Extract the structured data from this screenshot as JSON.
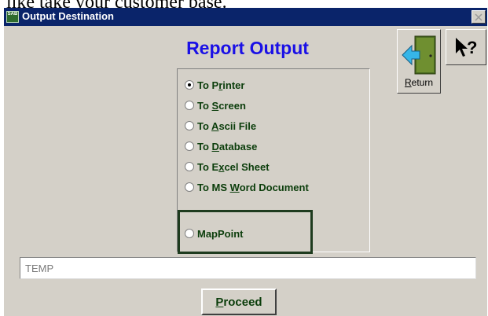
{
  "page": {
    "top_caption": "like take your customer base."
  },
  "window": {
    "title": "Output Destination",
    "app_icon_text": "SAB"
  },
  "report_title": "Report Output",
  "return_button": {
    "label_underlined": "R",
    "label_rest": "eturn"
  },
  "options": [
    {
      "pre": "To P",
      "accel": "r",
      "post": "inter",
      "selected": true
    },
    {
      "pre": "To ",
      "accel": "S",
      "post": "creen",
      "selected": false
    },
    {
      "pre": "To ",
      "accel": "A",
      "post": "scii File",
      "selected": false
    },
    {
      "pre": "To ",
      "accel": "D",
      "post": "atabase",
      "selected": false
    },
    {
      "pre": "To E",
      "accel": "x",
      "post": "cel Sheet",
      "selected": false
    },
    {
      "pre": "To MS ",
      "accel": "W",
      "post": "ord Document",
      "selected": false
    },
    {
      "pre": "MapPoint",
      "accel": "",
      "post": "",
      "selected": false
    }
  ],
  "temp_field": {
    "value": "TEMP"
  },
  "proceed_button": {
    "accel": "P",
    "rest": "roceed"
  },
  "colors": {
    "title_bar": "#0a246a",
    "report_title": "#1a10e6",
    "option_text": "#0b3d0b",
    "highlight_border": "#1e3b1e"
  }
}
